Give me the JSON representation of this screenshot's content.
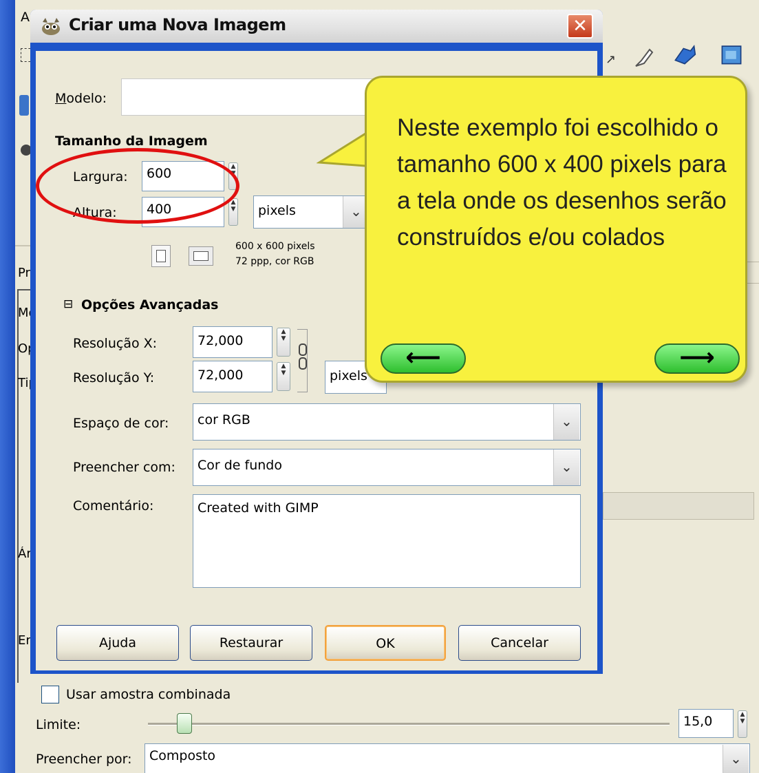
{
  "background_window": {
    "menu_partial": "Ar",
    "labels_partial": [
      "Pre",
      "Mo",
      "Op",
      "Tip",
      "Ár",
      "Er"
    ],
    "use_sample_merged": "Usar amostra combinada",
    "threshold_label": "Limite:",
    "threshold_value": "15,0",
    "threshold_level_percent": 7,
    "fill_by_label": "Preencher por:",
    "fill_by_value": "Composto"
  },
  "dialog": {
    "title": "Criar uma Nova Imagem",
    "close_glyph": "✕",
    "template_label": "Modelo:",
    "template_value": "",
    "image_size_heading": "Tamanho da Imagem",
    "width_label": "Largura:",
    "width_value": "600",
    "height_label": "Altura:",
    "height_value": "400",
    "unit_value": "pixels",
    "info_line1": "600 x 600 pixels",
    "info_line2": "72 ppp, cor RGB",
    "advanced_toggle": "⊟",
    "advanced_heading": "Opções Avançadas",
    "res_x_label": "Resolução X:",
    "res_x_value": "72,000",
    "res_y_label": "Resolução Y:",
    "res_y_value": "72,000",
    "res_unit_value": "pixels",
    "colorspace_label": "Espaço de cor:",
    "colorspace_value": "cor RGB",
    "fill_label": "Preencher com:",
    "fill_value": "Cor de fundo",
    "comment_label": "Comentário:",
    "comment_value": "Created with GIMP",
    "buttons": {
      "help": "Ajuda",
      "reset": "Restaurar",
      "ok": "OK",
      "cancel": "Cancelar"
    }
  },
  "callout": {
    "text": "Neste exemplo foi escolhido o tamanho 600 x 400 pixels para a tela onde os desenhos serão construídos e/ou colados",
    "prev_glyph": "⟵",
    "next_glyph": "⟶"
  },
  "colors": {
    "callout_fill": "#f8f13e",
    "highlight_ellipse": "#e01010",
    "nav_button": "#2fbf2f",
    "xp_title_blue": "#1d54c9"
  }
}
